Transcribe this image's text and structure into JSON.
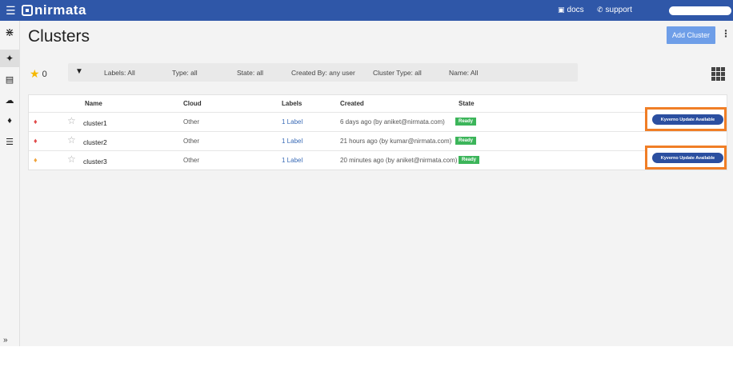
{
  "topbar": {
    "brand": "nirmata",
    "docs_label": "docs",
    "support_label": "support"
  },
  "page": {
    "title": "Clusters",
    "add_button": "Add Cluster",
    "more_menu": "⋮"
  },
  "favorites": {
    "count": "0"
  },
  "filters": {
    "labels": "Labels: All",
    "type": "Type: all",
    "state": "State: all",
    "created_by": "Created By: any user",
    "cluster_type": "Cluster Type: all",
    "name": "Name: All"
  },
  "table": {
    "columns": [
      "Name",
      "Cloud",
      "Labels",
      "Created",
      "State"
    ],
    "rows": [
      {
        "name": "cluster1",
        "cloud": "Other",
        "labels": "1 Label",
        "created": "6 days ago (by aniket@nirmata.com)",
        "state": "Ready",
        "alert_color": "#e14a4a",
        "action": "Kyverno Update Available"
      },
      {
        "name": "cluster2",
        "cloud": "Other",
        "labels": "1 Label",
        "created": "21 hours ago (by kumar@nirmata.com)",
        "state": "Ready",
        "alert_color": "#e14a4a",
        "action": ""
      },
      {
        "name": "cluster3",
        "cloud": "Other",
        "labels": "1 Label",
        "created": "20 minutes ago (by aniket@nirmata.com)",
        "state": "Ready",
        "alert_color": "#f0a23a",
        "action": "Kyverno Update Available"
      }
    ]
  },
  "colors": {
    "topbar": "#2f57a8",
    "accent_button": "#6e9ee8",
    "ready_badge": "#3cb55a",
    "kyverno_button": "#2b4fa0",
    "highlight_border": "#f07e26"
  }
}
